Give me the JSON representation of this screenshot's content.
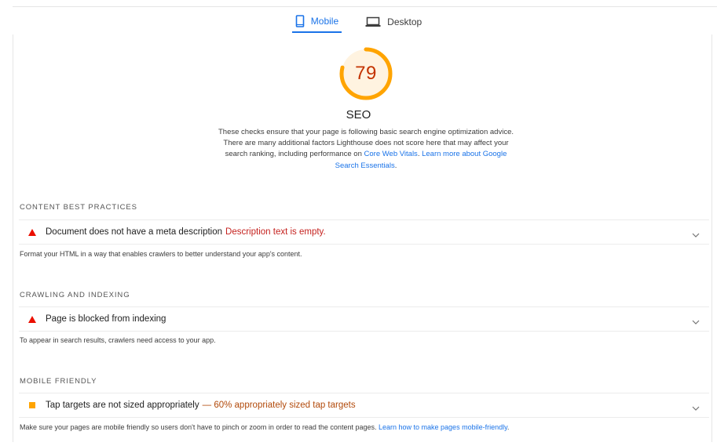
{
  "tabs": [
    {
      "label": "Mobile",
      "icon": "phone-icon",
      "active": true
    },
    {
      "label": "Desktop",
      "icon": "laptop-icon",
      "active": false
    }
  ],
  "score": {
    "value": "79",
    "fraction": 0.79,
    "color": "#ffa400",
    "text_color": "#c33300"
  },
  "category": {
    "title": "SEO",
    "description": "These checks ensure that your page is following basic search engine optimization advice. There are many additional factors Lighthouse does not score here that may affect your search ranking, including performance on",
    "link_cwv": "Core Web Vitals",
    "link_learn": "Learn more about Google Search Essentials"
  },
  "groups": [
    {
      "title": "CONTENT BEST PRACTICES",
      "audit": {
        "title": "Document does not have a meta description",
        "display": "Description text is empty.",
        "status": "fail"
      },
      "description": "Format your HTML in a way that enables crawlers to better understand your app's content."
    },
    {
      "title": "CRAWLING AND INDEXING",
      "audit": {
        "title": "Page is blocked from indexing",
        "display": "",
        "status": "fail"
      },
      "description": "To appear in search results, crawlers need access to your app."
    },
    {
      "title": "MOBILE FRIENDLY",
      "audit": {
        "title": "Tap targets are not sized appropriately",
        "display": "— 60% appropriately sized tap targets",
        "status": "average"
      },
      "description": "Make sure your pages are mobile friendly so users don't have to pinch or zoom in order to read the content pages.",
      "link": "Learn how to make pages mobile-friendly"
    }
  ],
  "colors": {
    "fail": "#eb0f00",
    "average": "#ffa400",
    "link": "#1a73e8"
  }
}
